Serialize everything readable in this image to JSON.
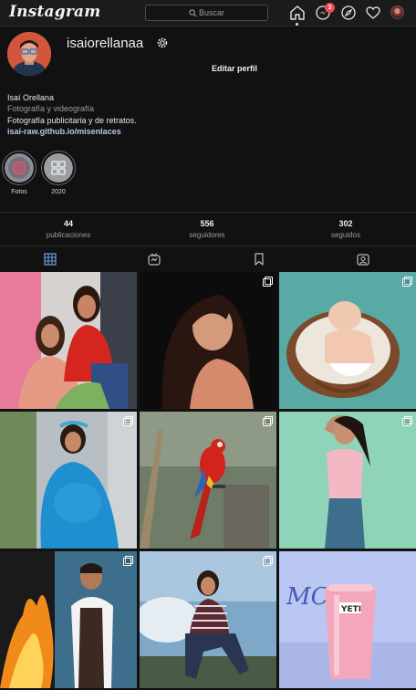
{
  "app": {
    "logo": "Instagram"
  },
  "nav": {
    "search_placeholder": "Buscar",
    "messages_badge": "3",
    "icons": [
      "home-icon",
      "messenger-icon",
      "explore-icon",
      "activity-heart-icon",
      "profile-avatar"
    ]
  },
  "profile": {
    "username": "isaiorellanaa",
    "edit_label": "Editar perfil",
    "name": "Isaí Orellana",
    "category": "Fotografía y videografía",
    "bio": "Fotografía publicitaria y de retratos.",
    "link": "isai-raw.github.io/misenlaces"
  },
  "highlights": [
    {
      "label": "Fotos"
    },
    {
      "label": "2020"
    }
  ],
  "stats": [
    {
      "value": "44",
      "label": "publicaciones"
    },
    {
      "value": "556",
      "label": "seguidores"
    },
    {
      "value": "302",
      "label": "seguidos"
    }
  ],
  "tabs": [
    "posts-grid-icon",
    "igtv-icon",
    "saved-icon",
    "tagged-icon"
  ],
  "active_tab": "posts-grid-icon",
  "colors": {
    "background": "#111111",
    "nav": "#1b1b1b",
    "badge": "#ed4956",
    "link": "#b8cbe8",
    "muted": "#9c9c9c"
  },
  "posts": [
    {
      "subject": "two women portrait in pink and red",
      "multiple": false
    },
    {
      "subject": "woman profile portrait dark background",
      "multiple": true
    },
    {
      "subject": "newborn sleeping in basket",
      "multiple": true
    },
    {
      "subject": "maternity portrait in blue dress",
      "multiple": true
    },
    {
      "subject": "scarlet macaw on post",
      "multiple": true
    },
    {
      "subject": "woman in pink top on green background",
      "multiple": true
    },
    {
      "subject": "chef with flames",
      "multiple": true
    },
    {
      "subject": "woman sitting outdoors",
      "multiple": true
    },
    {
      "subject": "pink YETI tumbler product shot",
      "multiple": false
    }
  ]
}
